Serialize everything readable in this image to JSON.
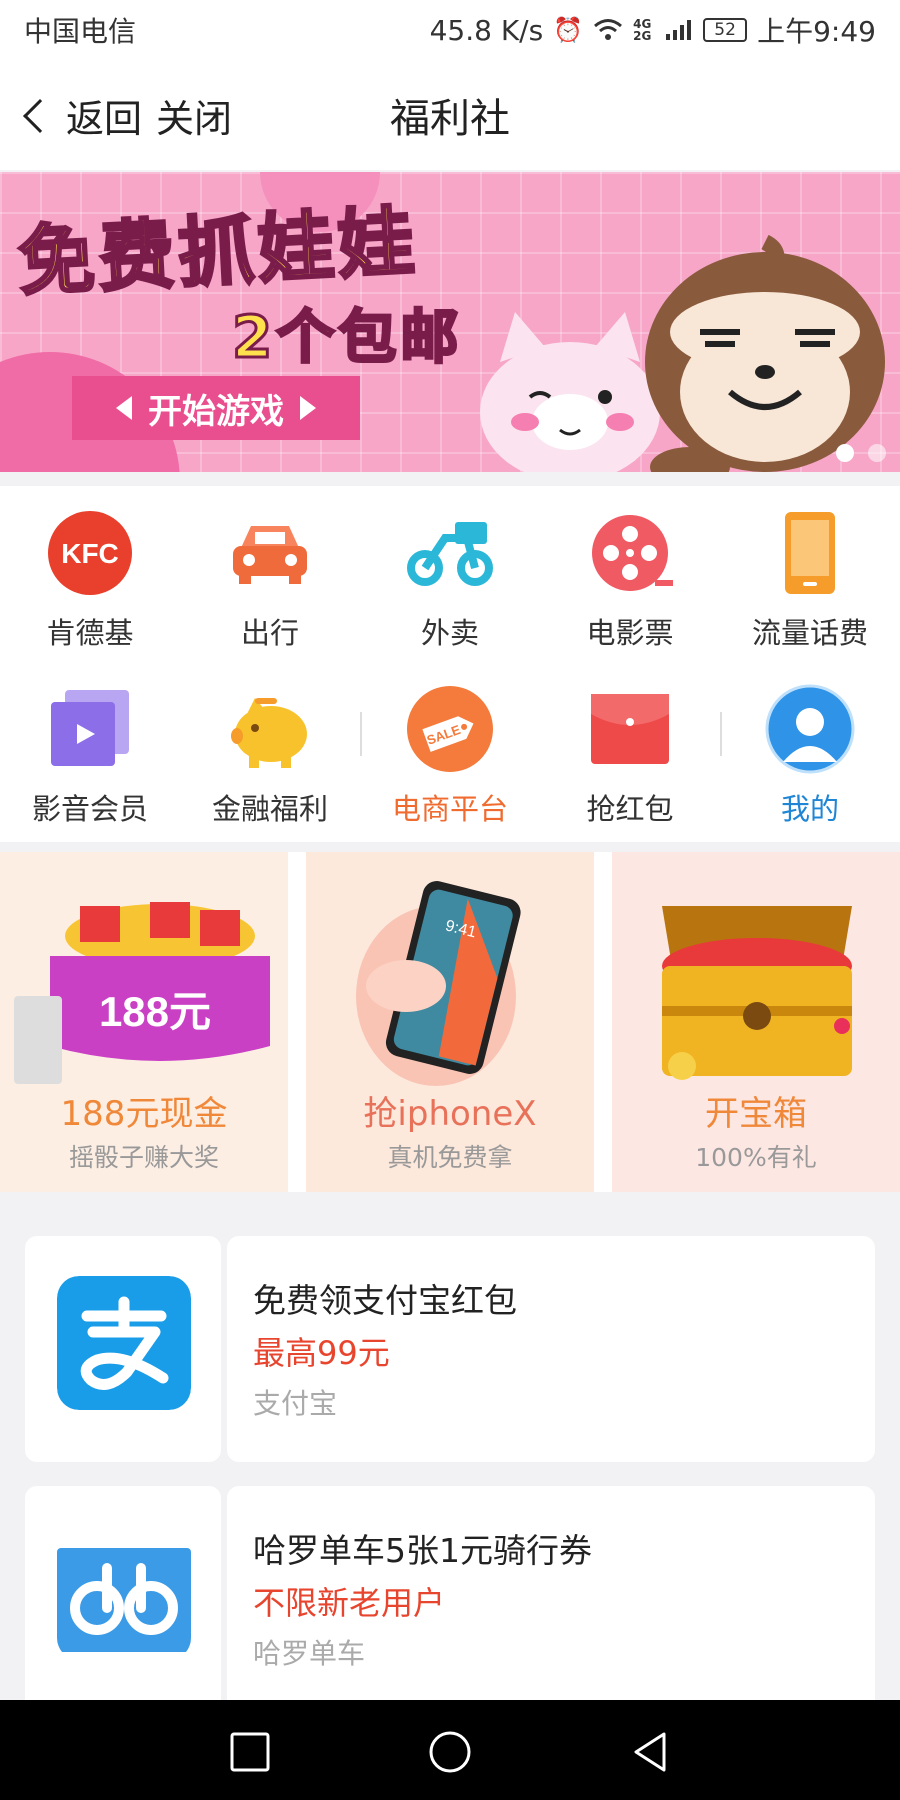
{
  "status_bar": {
    "carrier": "中国电信",
    "net_speed": "45.8 K/s",
    "signal_tag": "4G 2G",
    "battery": "52",
    "time": "上午9:49"
  },
  "nav": {
    "back_label": "返回",
    "close_label": "关闭",
    "title": "福利社"
  },
  "banner": {
    "headline": "免费抓娃娃",
    "subline": "2个包邮",
    "cta": "开始游戏",
    "page_count": 2,
    "active_page": 1
  },
  "grid": {
    "items": [
      {
        "label": "肯德基",
        "icon": "kfc-icon"
      },
      {
        "label": "出行",
        "icon": "car-icon"
      },
      {
        "label": "外卖",
        "icon": "delivery-scooter-icon"
      },
      {
        "label": "电影票",
        "icon": "film-reel-icon"
      },
      {
        "label": "流量话费",
        "icon": "phone-icon"
      },
      {
        "label": "影音会员",
        "icon": "video-play-icon"
      },
      {
        "label": "金融福利",
        "icon": "piggy-bank-icon"
      },
      {
        "label": "电商平台",
        "icon": "sale-tag-icon"
      },
      {
        "label": "抢红包",
        "icon": "red-envelope-icon"
      },
      {
        "label": "我的",
        "icon": "user-avatar-icon"
      }
    ]
  },
  "promos": [
    {
      "title": "188元现金",
      "subtitle": "摇骰子赚大奖",
      "badge": "188元",
      "color": "#f0883a"
    },
    {
      "title": "抢iphoneX",
      "subtitle": "真机免费拿",
      "screen_time": "9:41",
      "color": "#e8715a"
    },
    {
      "title": "开宝箱",
      "subtitle": "100%有礼",
      "color": "#f0883a"
    }
  ],
  "offers": [
    {
      "title": "免费领支付宝红包",
      "highlight": "最高99元",
      "source": "支付宝",
      "logo": "alipay-logo-icon",
      "logo_color": "#1a9de8"
    },
    {
      "title": "哈罗单车5张1元骑行券",
      "highlight": "不限新老用户",
      "source": "哈罗单车",
      "logo": "hellobike-logo-icon",
      "logo_color": "#3b9be6"
    }
  ],
  "colors": {
    "accent_red": "#e8452f",
    "accent_orange": "#f06b2f",
    "accent_blue": "#1f86d6",
    "banner_pink": "#f7a6c8"
  }
}
